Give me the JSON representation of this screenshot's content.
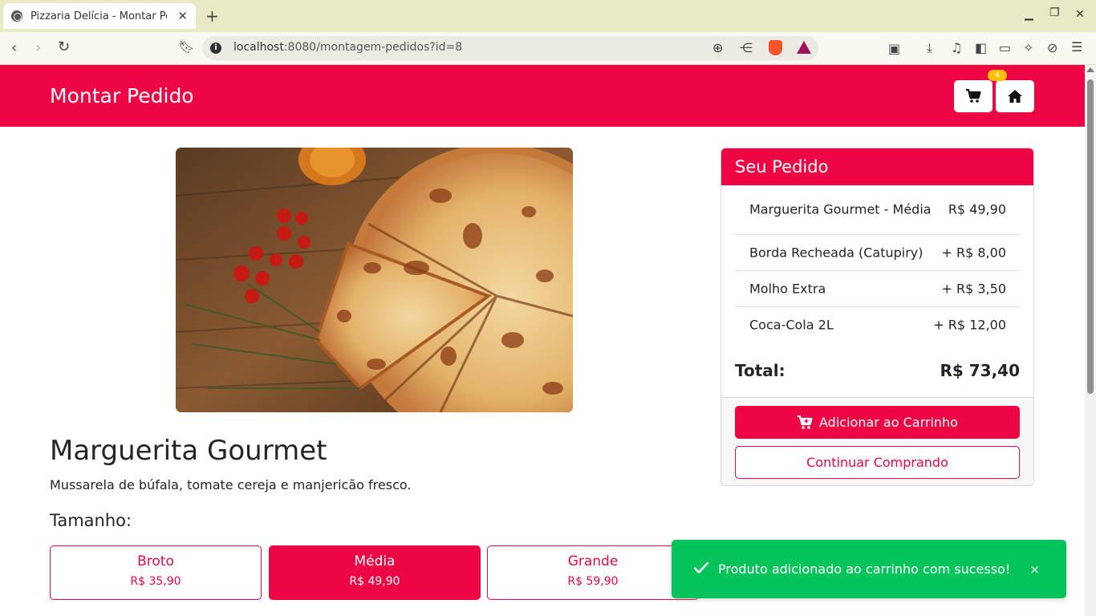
{
  "browser": {
    "tab_title": "Pizzaria Delícia - Montar Pedido",
    "url_host": "localhost",
    "url_rest": ":8080/montagem-pedidos?id=8"
  },
  "header": {
    "title": "Montar Pedido",
    "cart_count": "4"
  },
  "product": {
    "name": "Marguerita Gourmet",
    "description": "Mussarela de búfala, tomate cereja e manjericão fresco.",
    "size_heading": "Tamanho:",
    "sizes": [
      {
        "name": "Broto",
        "price": "R$ 35,90",
        "selected": false
      },
      {
        "name": "Média",
        "price": "R$ 49,90",
        "selected": true
      },
      {
        "name": "Grande",
        "price": "R$ 59,90",
        "selected": false
      }
    ]
  },
  "order": {
    "title": "Seu Pedido",
    "items": [
      {
        "name": "Marguerita Gourmet - Média",
        "price": "R$ 49,90"
      },
      {
        "name": "Borda Recheada (Catupiry)",
        "price": "+ R$ 8,00"
      },
      {
        "name": "Molho Extra",
        "price": "+ R$ 3,50"
      },
      {
        "name": "Coca-Cola 2L",
        "price": "+ R$ 12,00"
      }
    ],
    "total_label": "Total:",
    "total_value": "R$ 73,40",
    "add_button": "Adicionar ao Carrinho",
    "continue_button": "Continuar Comprando"
  },
  "toast": {
    "message": "Produto adicionado ao carrinho com sucesso!",
    "close": "×"
  },
  "colors": {
    "brand": "#ee0543",
    "success": "#03c35b",
    "badge": "#ffc107"
  }
}
